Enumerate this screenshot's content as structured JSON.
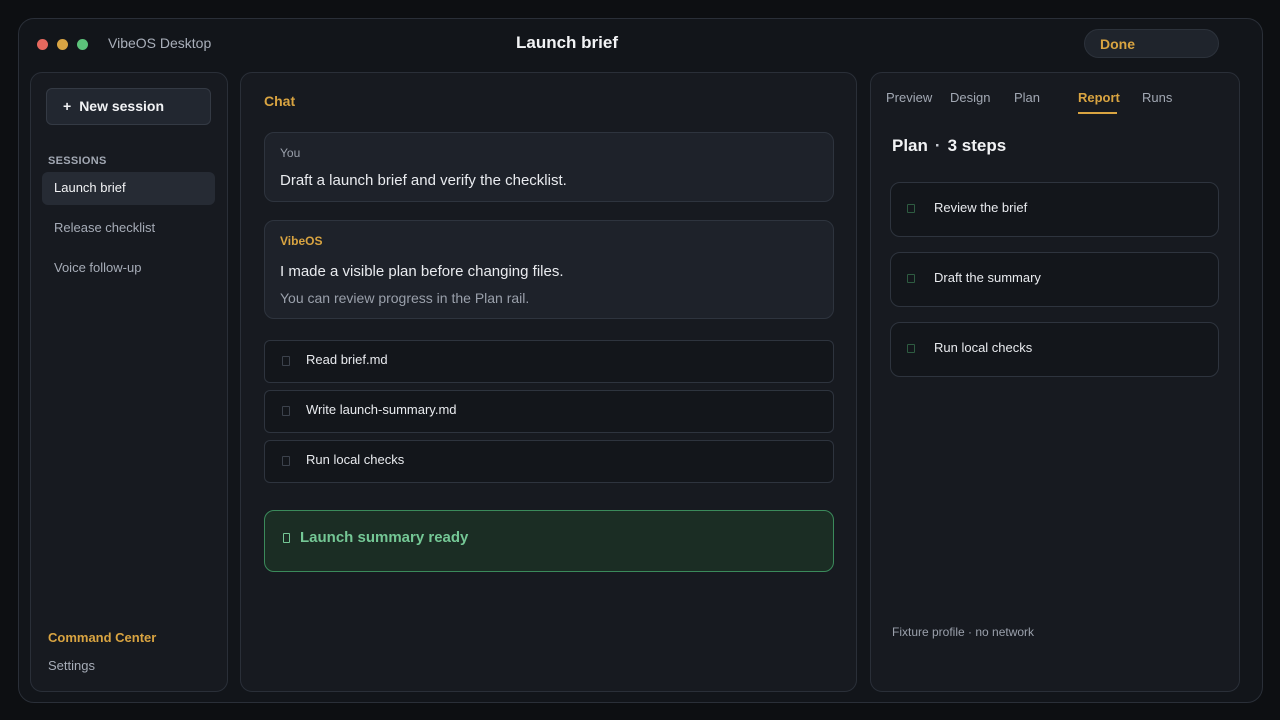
{
  "window": {
    "app_name": "VibeOS Desktop",
    "title": "Launch brief",
    "status": "Done"
  },
  "sidebar": {
    "new_session_icon": "+",
    "new_session_label": "New session",
    "sessions_heading": "SESSIONS",
    "sessions": [
      {
        "label": "Launch brief",
        "active": true
      },
      {
        "label": "Release checklist",
        "active": false
      },
      {
        "label": "Voice follow-up",
        "active": false
      }
    ],
    "command_center": "Command Center",
    "settings": "Settings"
  },
  "chat": {
    "heading": "Chat",
    "user_message": {
      "author": "You",
      "text": "Draft a launch brief and verify the checklist."
    },
    "assistant_message": {
      "author": "VibeOS",
      "text": "I made a visible plan before changing files.",
      "subtext": "You can review progress in the Plan rail."
    },
    "tasks": [
      {
        "label": "Read brief.md",
        "icon": "checkbox-icon"
      },
      {
        "label": "Write launch-summary.md",
        "icon": "checkbox-icon"
      },
      {
        "label": "Run local checks",
        "icon": "checkbox-icon"
      }
    ],
    "result": {
      "icon": "check-icon",
      "label": "Launch summary ready"
    }
  },
  "right_panel": {
    "tabs": [
      {
        "label": "Preview",
        "active": false
      },
      {
        "label": "Design",
        "active": false
      },
      {
        "label": "Plan",
        "active": false
      },
      {
        "label": "Report",
        "active": true
      },
      {
        "label": "Runs",
        "active": false
      }
    ],
    "plan_title": "Plan",
    "plan_separator": "·",
    "plan_count": "3 steps",
    "steps": [
      {
        "label": "Review the brief",
        "icon": "step-check-icon"
      },
      {
        "label": "Draft the summary",
        "icon": "step-check-icon"
      },
      {
        "label": "Run local checks",
        "icon": "step-check-icon"
      }
    ],
    "footer": "Fixture profile · no network"
  },
  "colors": {
    "accent": "#d9a441",
    "success": "#74c795",
    "background": "#0d0f12",
    "panel": "#171a20"
  }
}
